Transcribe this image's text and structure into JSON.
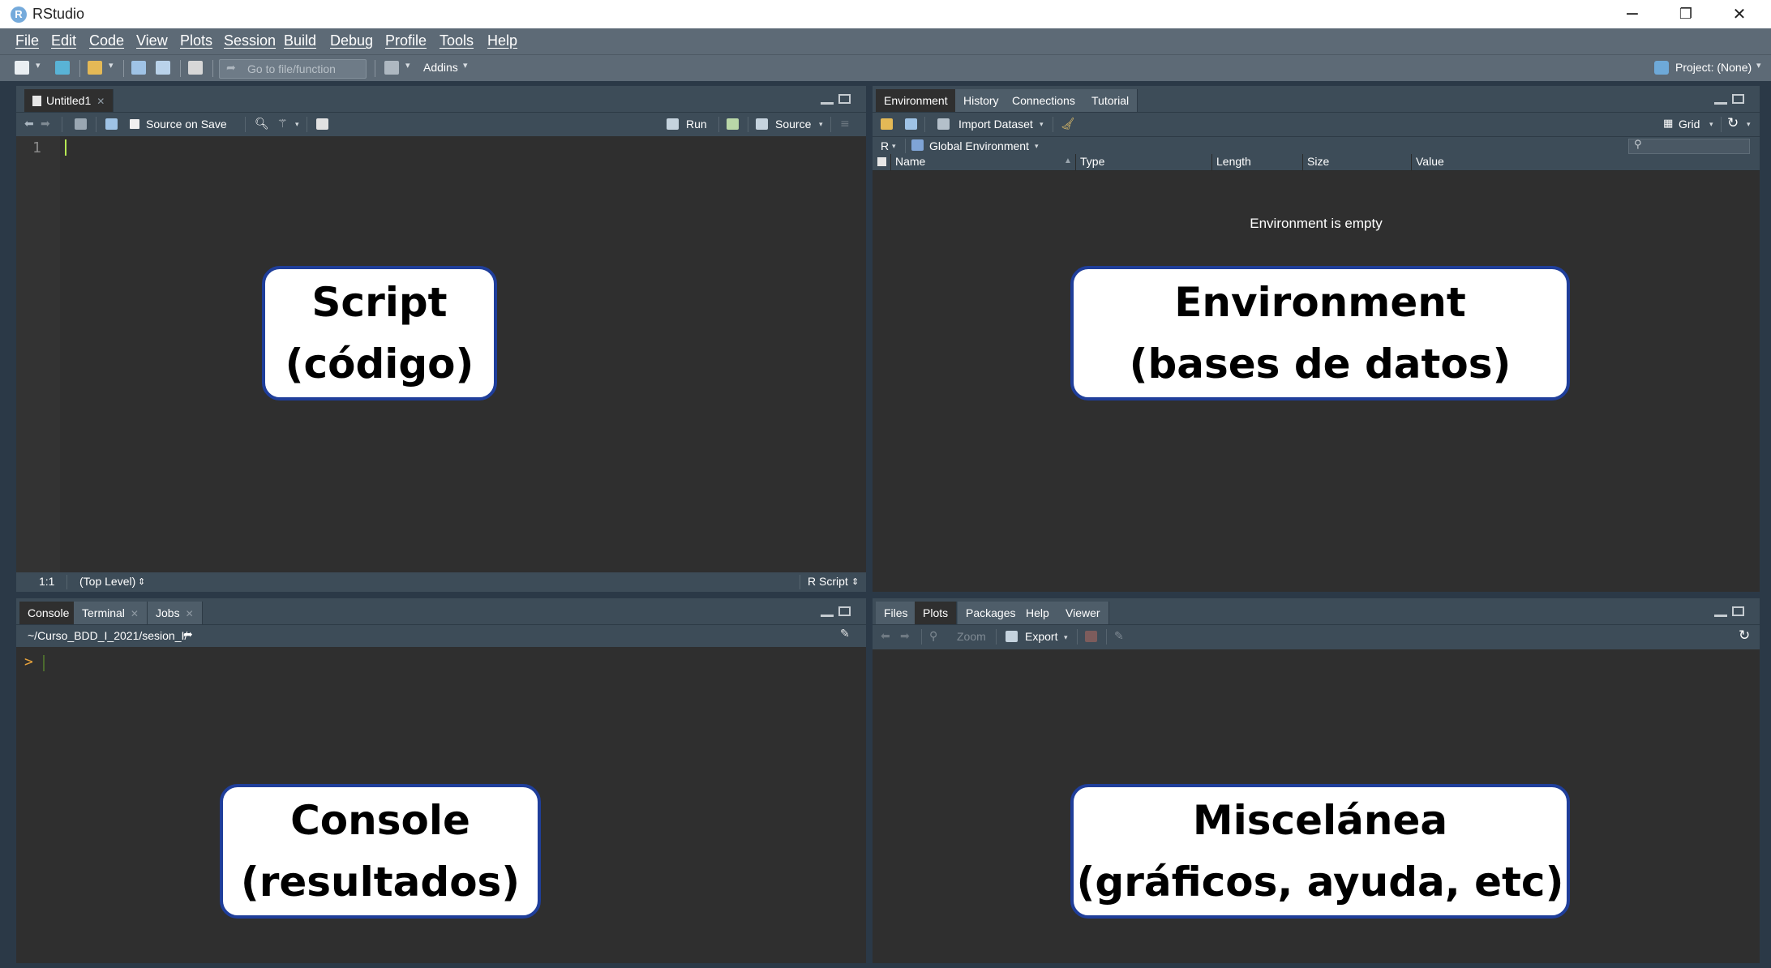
{
  "window": {
    "title": "RStudio",
    "app_icon_letter": "R",
    "controls": [
      "−",
      "❐",
      "✕"
    ]
  },
  "menu": [
    "File",
    "Edit",
    "Code",
    "View",
    "Plots",
    "Session",
    "Build",
    "Debug",
    "Profile",
    "Tools",
    "Help"
  ],
  "toolbar": {
    "goto_placeholder": "Go to file/function",
    "addins_label": "Addins",
    "project_label": "Project: (None)"
  },
  "source_pane": {
    "tab_label": "Untitled1",
    "source_on_save_label": "Source on Save",
    "run_label": "Run",
    "source_label": "Source",
    "line_number": "1",
    "status": {
      "position": "1:1",
      "scope": "(Top Level)",
      "file_type": "R Script"
    }
  },
  "environment_pane": {
    "tabs": [
      "Environment",
      "History",
      "Connections",
      "Tutorial"
    ],
    "import_dataset_label": "Import Dataset",
    "grid_label": "Grid",
    "r_label": "R",
    "scope_label": "Global Environment",
    "columns": [
      "Name",
      "Type",
      "Length",
      "Size",
      "Value"
    ],
    "empty_message": "Environment is empty"
  },
  "console_pane": {
    "tabs": [
      "Console",
      "Terminal",
      "Jobs"
    ],
    "working_dir": "~/Curso_BDD_I_2021/sesion_I/",
    "prompt": ">"
  },
  "files_pane": {
    "tabs": [
      "Files",
      "Plots",
      "Packages",
      "Help",
      "Viewer"
    ],
    "zoom_label": "Zoom",
    "export_label": "Export"
  },
  "callouts": {
    "script": {
      "line1": "Script",
      "line2": "(código)"
    },
    "environment": {
      "line1": "Environment",
      "line2": "(bases de datos)"
    },
    "console": {
      "line1": "Console",
      "line2": "(resultados)"
    },
    "misc": {
      "line1": "Miscelánea",
      "line2": "(gráficos, ayuda, etc)"
    }
  },
  "colors": {
    "chrome": "#5d6a76",
    "pane_header": "#3d4c58",
    "pane_bg": "#2f2f2f",
    "callout_border": "#1f3e9a",
    "cursor": "#b5e853",
    "prompt": "#e8a33c"
  }
}
